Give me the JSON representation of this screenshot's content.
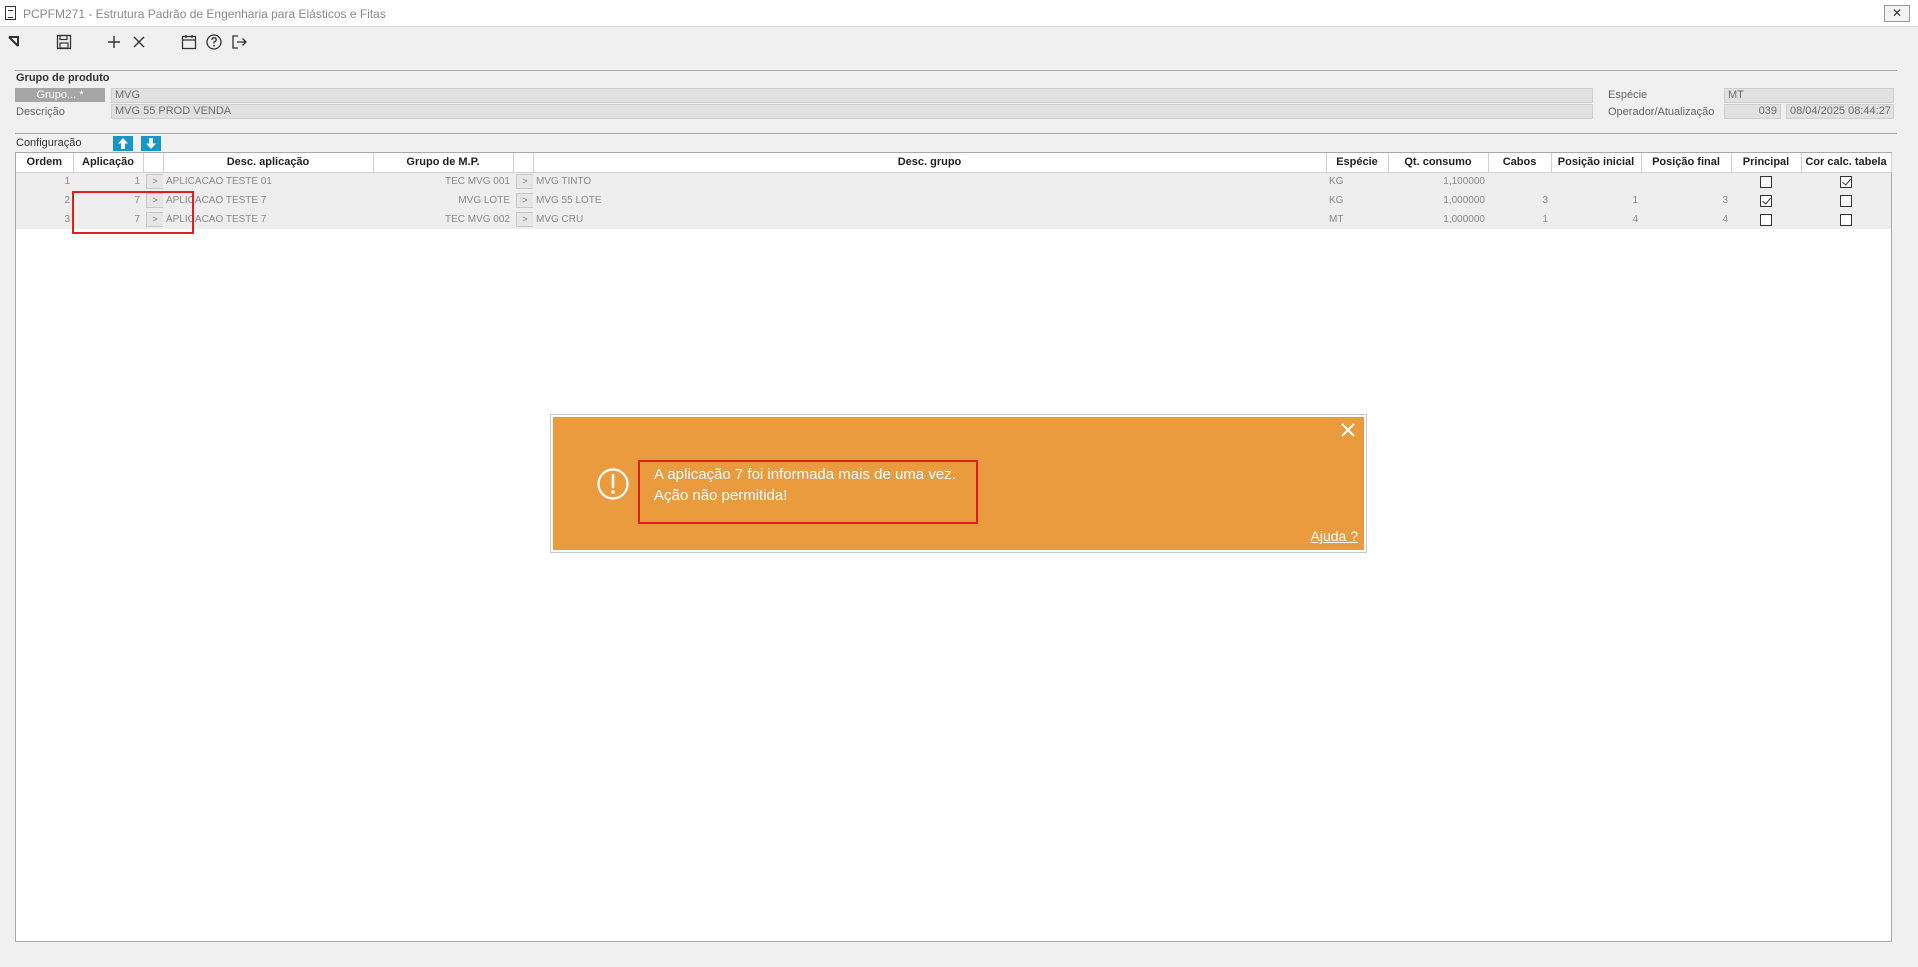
{
  "window": {
    "title": "PCPFM271 - Estrutura Padrão de Engenharia para Elásticos e Fitas",
    "close_label": "✕"
  },
  "toolbar": {
    "icons": [
      "nav-icon",
      "save-icon",
      "add-icon",
      "delete-icon",
      "calendar-icon",
      "help-icon",
      "exit-icon"
    ]
  },
  "grupo_produto": {
    "section_label": "Grupo de produto",
    "grupo_button": "Grupo... *",
    "grupo_value": "MVG",
    "descricao_label": "Descrição",
    "descricao_value": "MVG 55 PROD VENDA",
    "especie_label": "Espécie",
    "especie_value": "MT",
    "operador_label": "Operador/Atualização",
    "operador_value": "039",
    "atualizacao_value": "08/04/2025 08:44:27"
  },
  "configuracao": {
    "section_label": "Configuração",
    "columns": [
      "Ordem",
      "Aplicação",
      "",
      "Desc. aplicação",
      "Grupo de M.P.",
      "",
      "Desc. grupo",
      "Espécie",
      "Qt. consumo",
      "Cabos",
      "Posição inicial",
      "Posição final",
      "Principal",
      "Cor calc. tabela"
    ],
    "rows": [
      {
        "ordem": "1",
        "aplicacao": "1",
        "btn": ">",
        "desc_aplicacao": "APLICACAO TESTE 01",
        "grupo_mp": "TEC MVG 001",
        "btn2": ">",
        "desc_grupo": "MVG TINTO",
        "especie": "KG",
        "qt_consumo": "1,100000",
        "cabos": "",
        "pos_inicial": "",
        "pos_final": "",
        "principal": false,
        "cor_calc": true
      },
      {
        "ordem": "2",
        "aplicacao": "7",
        "btn": ">",
        "desc_aplicacao": "APLICACAO TESTE 7",
        "grupo_mp": "MVG LOTE",
        "btn2": ">",
        "desc_grupo": "MVG 55 LOTE",
        "especie": "KG",
        "qt_consumo": "1,000000",
        "cabos": "3",
        "pos_inicial": "1",
        "pos_final": "3",
        "principal": true,
        "cor_calc": false
      },
      {
        "ordem": "3",
        "aplicacao": "7",
        "btn": ">",
        "desc_aplicacao": "APLICACAO TESTE 7",
        "grupo_mp": "TEC MVG 002",
        "btn2": ">",
        "desc_grupo": "MVG CRU",
        "especie": "MT",
        "qt_consumo": "1,000000",
        "cabos": "1",
        "pos_inicial": "4",
        "pos_final": "4",
        "principal": false,
        "cor_calc": false
      }
    ]
  },
  "alert": {
    "line1": "A aplicação 7 foi informada mais de uma vez.",
    "line2": "Ação não permitida!",
    "help_link": "Ajuda ?",
    "background": "#ea9b3e"
  },
  "colors": {
    "arrow_buttons": "#1796c8",
    "highlight": "#e02020"
  }
}
